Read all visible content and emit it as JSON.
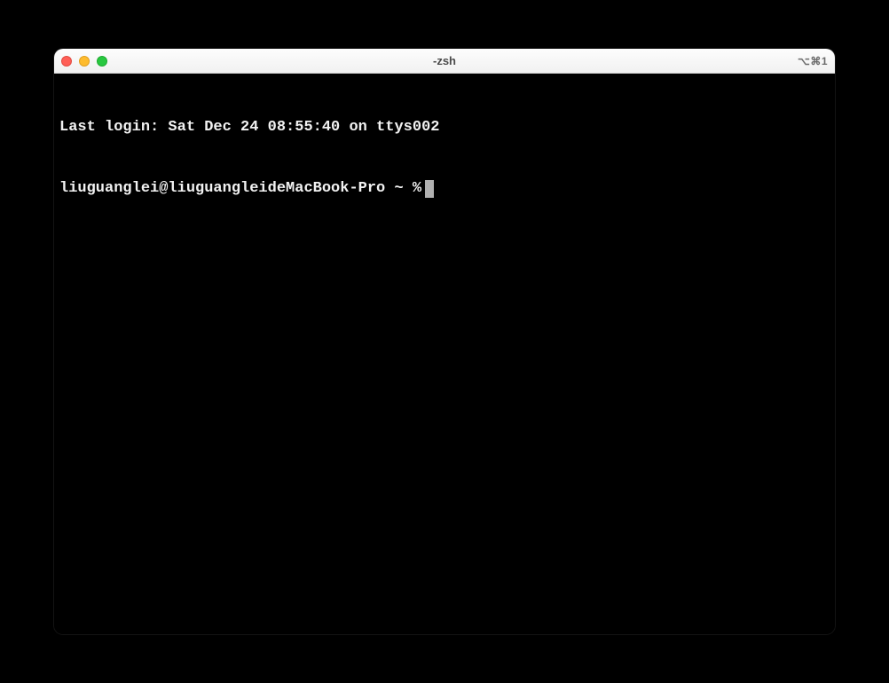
{
  "window": {
    "title": "-zsh",
    "shortcut": "⌥⌘1"
  },
  "terminal": {
    "last_login_line": "Last login: Sat Dec 24 08:55:40 on ttys002",
    "prompt": "liuguanglei@liuguangleideMacBook-Pro ~ %"
  }
}
